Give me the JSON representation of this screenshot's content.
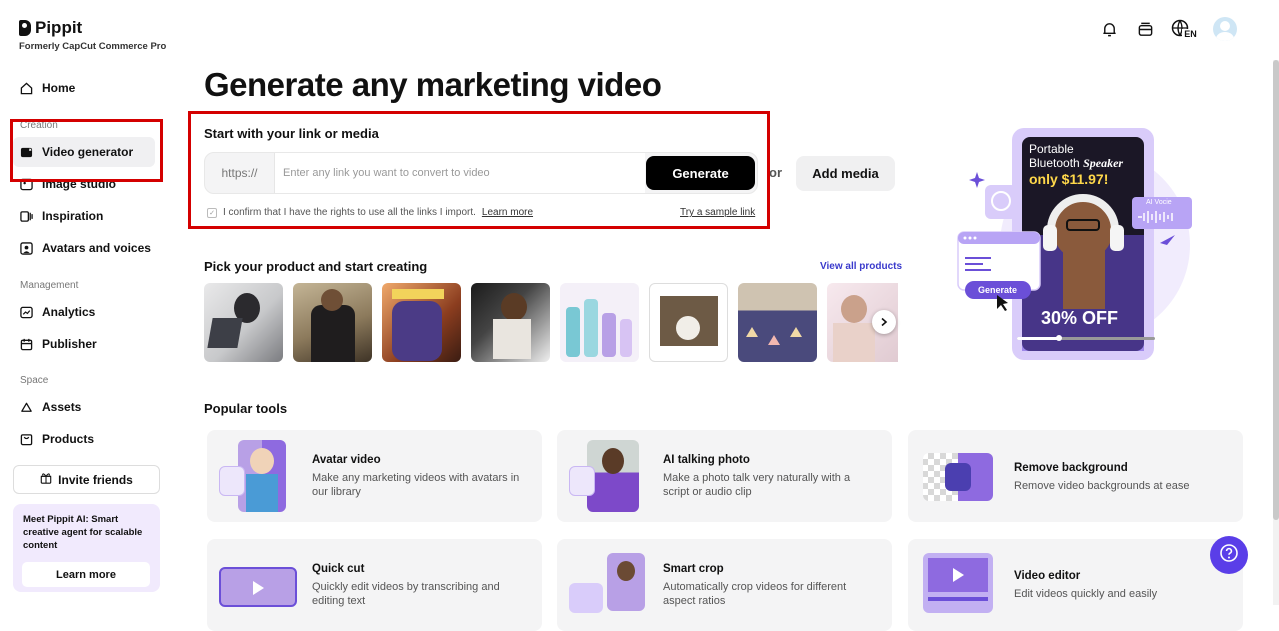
{
  "brand": {
    "name": "Pippit",
    "subtitle": "Formerly CapCut Commerce Pro"
  },
  "sidebar": {
    "home": "Home",
    "creation_label": "Creation",
    "creation_items": [
      {
        "label": "Video generator",
        "icon": "video-generator-icon",
        "active": true
      },
      {
        "label": "Image studio",
        "icon": "image-studio-icon"
      },
      {
        "label": "Inspiration",
        "icon": "inspiration-icon"
      },
      {
        "label": "Avatars and voices",
        "icon": "avatars-icon"
      }
    ],
    "management_label": "Management",
    "management_items": [
      {
        "label": "Analytics",
        "icon": "analytics-icon"
      },
      {
        "label": "Publisher",
        "icon": "calendar-icon"
      }
    ],
    "space_label": "Space",
    "space_items": [
      {
        "label": "Assets",
        "icon": "cloud-icon"
      },
      {
        "label": "Products",
        "icon": "bag-icon"
      }
    ],
    "invite": "Invite friends",
    "promo_text": "Meet Pippit AI: Smart creative agent for scalable content",
    "promo_button": "Learn more"
  },
  "header": {
    "language": "EN"
  },
  "main": {
    "title": "Generate any marketing video",
    "link_section_title": "Start with your link or media",
    "https_prefix": "https://",
    "link_placeholder": "Enter any link you want to convert to video",
    "generate_button": "Generate",
    "or_label": "or",
    "add_media_button": "Add media",
    "confirm_text": "I confirm that I have the rights to use all the links I import.",
    "confirm_link": "Learn more",
    "sample_link": "Try a sample link",
    "pick_title": "Pick your product and start creating",
    "view_all": "View all products",
    "popular_title": "Popular tools"
  },
  "hero": {
    "line1": "Portable",
    "line2": "Bluetooth",
    "line2b": "Speaker",
    "price": "only $11.97!",
    "ai_voice": "AI Vocie",
    "generate": "Generate",
    "off": "30% OFF"
  },
  "tools": [
    {
      "title": "Avatar video",
      "desc": "Make any marketing videos with avatars in our library"
    },
    {
      "title": "AI talking photo",
      "desc": "Make a photo talk very naturally with a script or audio clip"
    },
    {
      "title": "Remove background",
      "desc": "Remove video backgrounds at ease"
    },
    {
      "title": "Quick cut",
      "desc": "Quickly edit videos by transcribing and editing text"
    },
    {
      "title": "Smart crop",
      "desc": "Automatically crop videos for different aspect ratios"
    },
    {
      "title": "Video editor",
      "desc": "Edit videos quickly and easily"
    }
  ],
  "colors": {
    "highlight": "#d40000",
    "accent": "#5a3ee8",
    "link": "#3a3acc"
  }
}
